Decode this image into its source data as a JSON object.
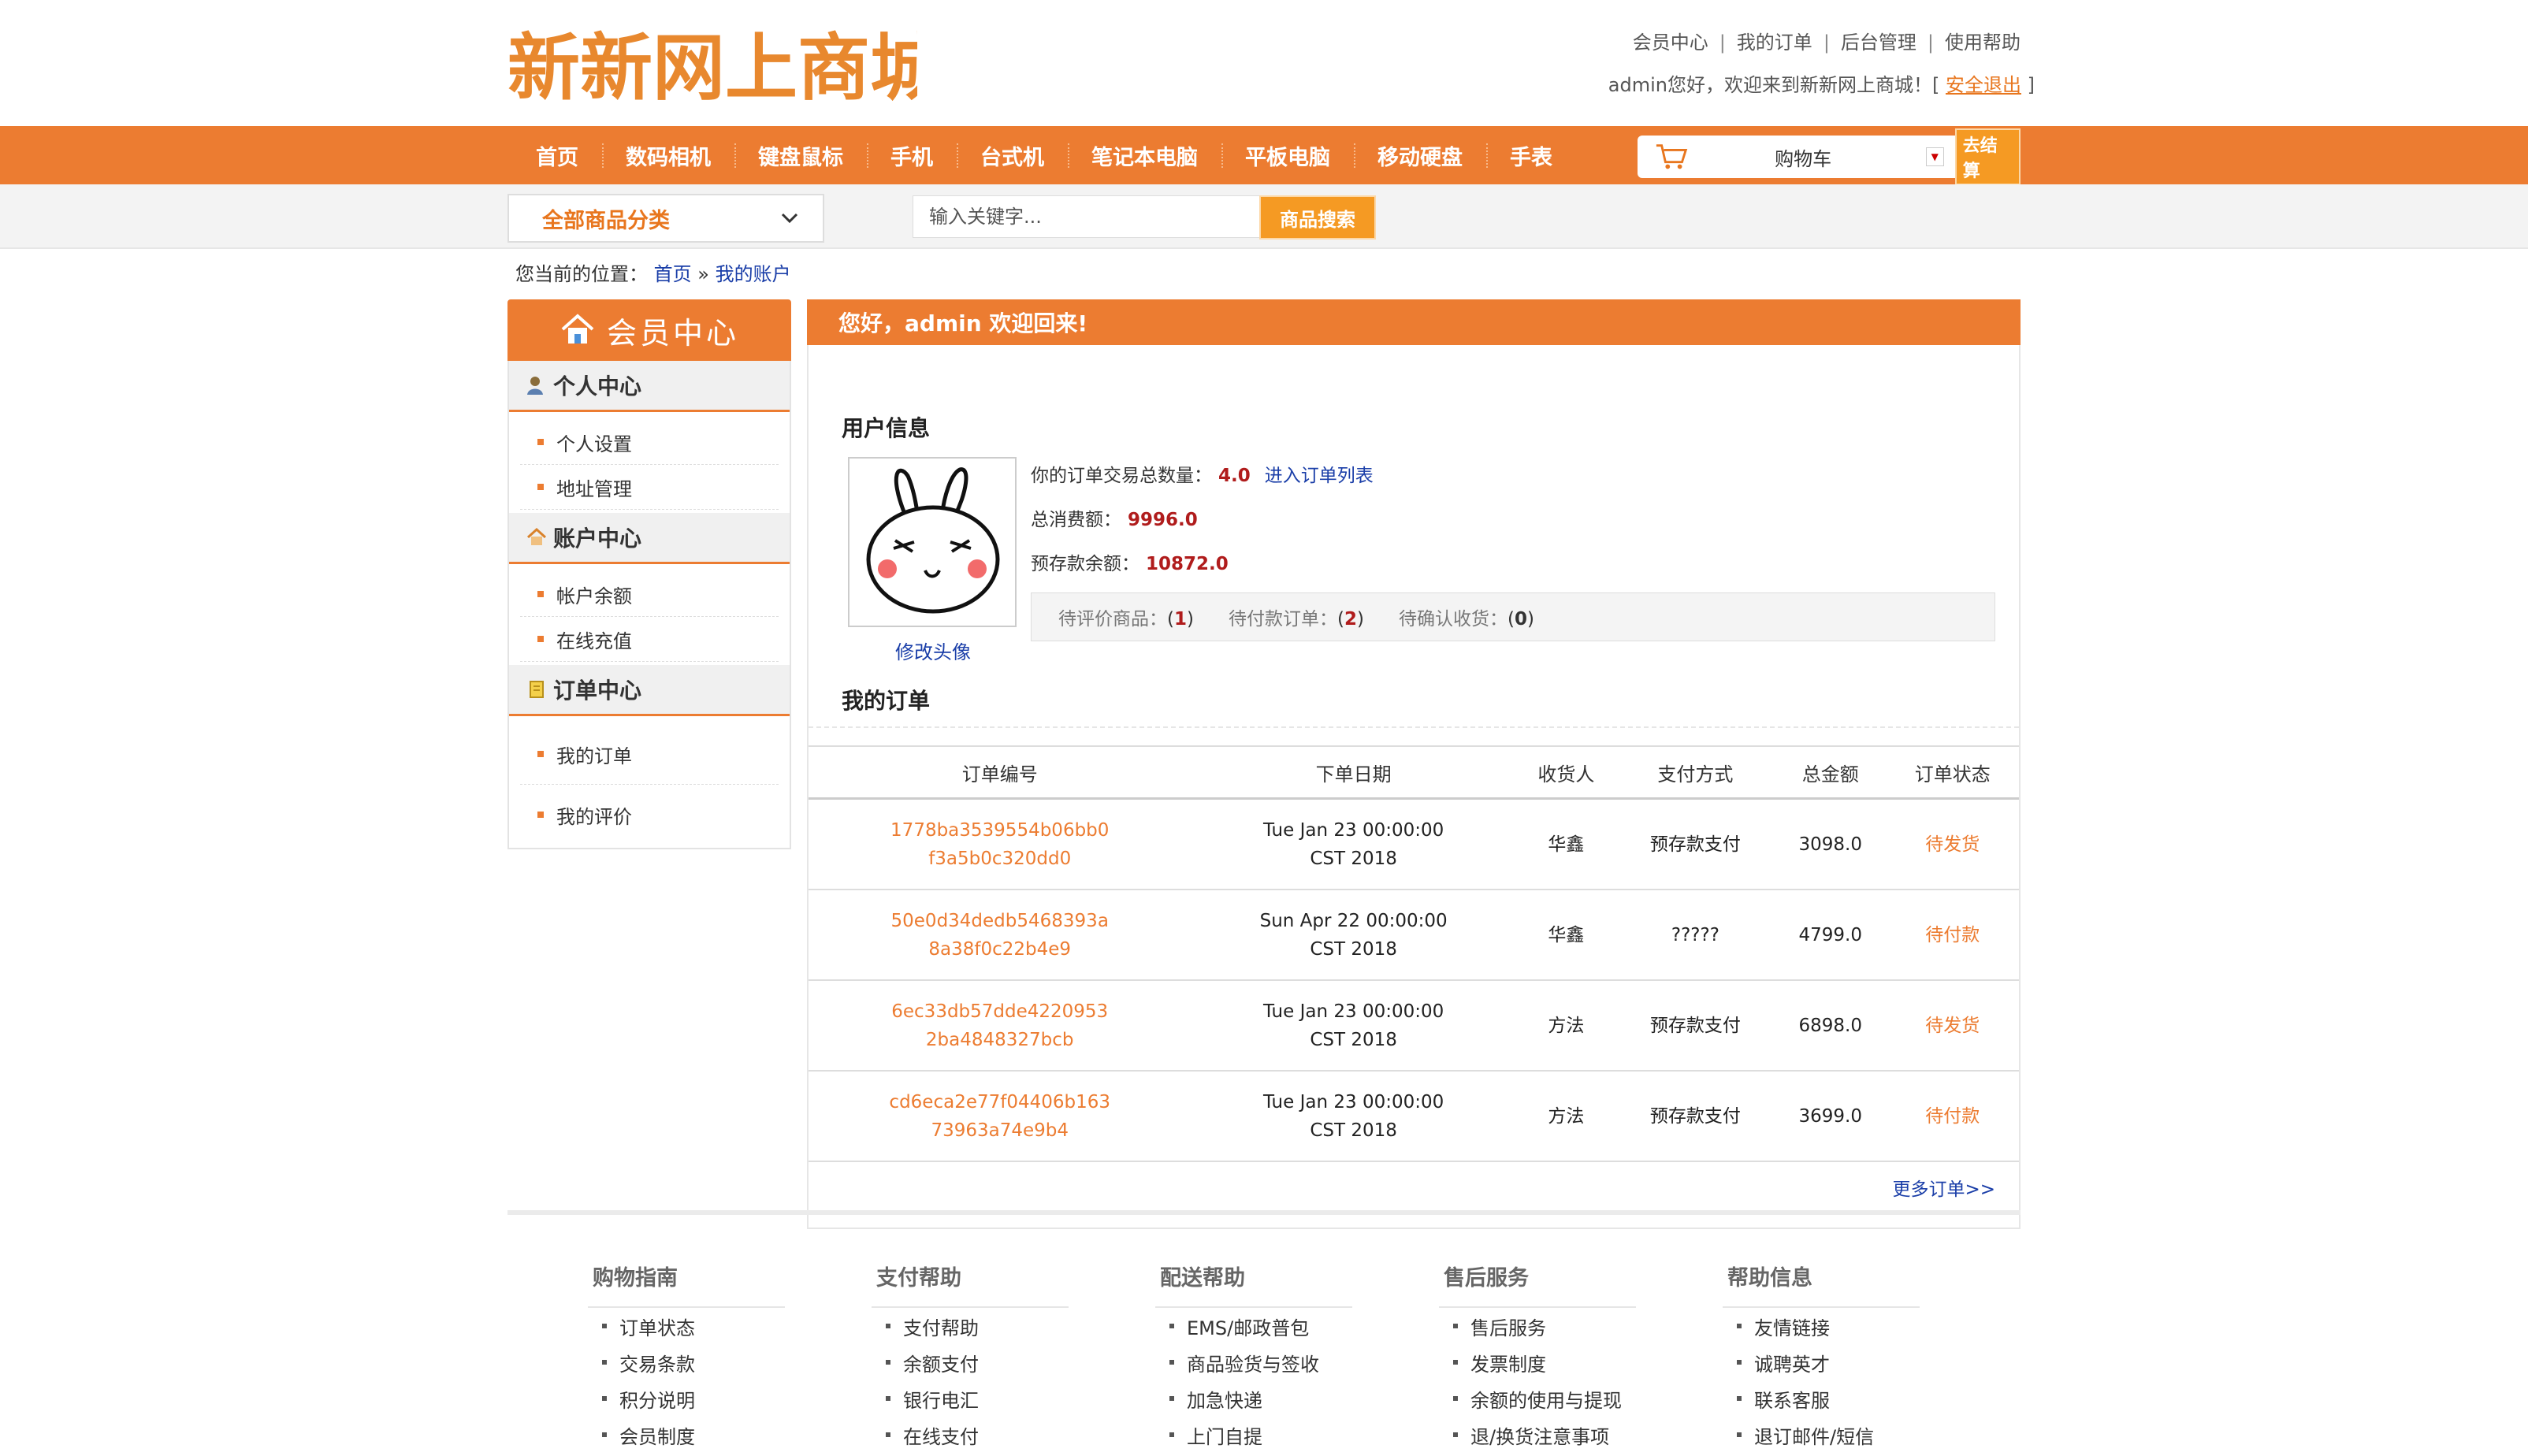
{
  "header": {
    "logo_text": "新新网上商城",
    "top_links": [
      "会员中心",
      "我的订单",
      "后台管理",
      "使用帮助"
    ],
    "greeting": "admin您好，欢迎来到新新网上商城！[",
    "logout": "安全退出",
    "greeting_end": "]"
  },
  "nav": {
    "items": [
      "首页",
      "数码相机",
      "键盘鼠标",
      "手机",
      "台式机",
      "笔记本电脑",
      "平板电脑",
      "移动硬盘",
      "手表"
    ],
    "cart_label": "购物车",
    "checkout": "去结算"
  },
  "subbar": {
    "category": "全部商品分类",
    "search_placeholder": "输入关键字...",
    "search_button": "商品搜索"
  },
  "breadcrumb": {
    "prefix": "您当前的位置：",
    "home": "首页",
    "sep": "»",
    "current": "我的账户"
  },
  "sidebar": {
    "title": "会员中心",
    "sections": [
      {
        "title": "个人中心",
        "items": [
          "个人设置",
          "地址管理"
        ]
      },
      {
        "title": "账户中心",
        "items": [
          "帐户余额",
          "在线充值"
        ]
      },
      {
        "title": "订单中心",
        "items": [
          "我的订单",
          "我的评价"
        ]
      }
    ]
  },
  "main": {
    "welcome": "您好，admin 欢迎回来!",
    "user_info_title": "用户信息",
    "edit_avatar": "修改头像",
    "order_count_label": "你的订单交易总数量：",
    "order_count": "4.0",
    "order_list_link": "进入订单列表",
    "total_spent_label": "总消费额：",
    "total_spent": "9996.0",
    "balance_label": "预存款余额：",
    "balance": "10872.0",
    "pending": {
      "review_label": "待评价商品：",
      "review_count": "1",
      "unpaid_label": "待付款订单：",
      "unpaid_count": "2",
      "confirm_label": "待确认收货：",
      "confirm_count": "0",
      "open": "(",
      "close": ")"
    },
    "orders_title": "我的订单",
    "orders_headers": [
      "订单编号",
      "下单日期",
      "收货人",
      "支付方式",
      "总金额",
      "订单状态"
    ],
    "orders": [
      {
        "id1": "1778ba3539554b06bb0",
        "id2": "f3a5b0c320dd0",
        "date1": "Tue Jan 23 00:00:00",
        "date2": "CST 2018",
        "receiver": "华鑫",
        "payment": "预存款支付",
        "amount": "3098.0",
        "status": "待发货"
      },
      {
        "id1": "50e0d34dedb5468393a",
        "id2": "8a38f0c22b4e9",
        "date1": "Sun Apr 22 00:00:00",
        "date2": "CST 2018",
        "receiver": "华鑫",
        "payment": "?????",
        "amount": "4799.0",
        "status": "待付款"
      },
      {
        "id1": "6ec33db57dde4220953",
        "id2": "2ba4848327bcb",
        "date1": "Tue Jan 23 00:00:00",
        "date2": "CST 2018",
        "receiver": "方法",
        "payment": "预存款支付",
        "amount": "6898.0",
        "status": "待发货"
      },
      {
        "id1": "cd6eca2e77f04406b163",
        "id2": "73963a74e9b4",
        "date1": "Tue Jan 23 00:00:00",
        "date2": "CST 2018",
        "receiver": "方法",
        "payment": "预存款支付",
        "amount": "3699.0",
        "status": "待付款"
      }
    ],
    "more_orders": "更多订单>>"
  },
  "footer": {
    "columns": [
      {
        "title": "购物指南",
        "items": [
          "订单状态",
          "交易条款",
          "积分说明",
          "会员制度"
        ]
      },
      {
        "title": "支付帮助",
        "items": [
          "支付帮助",
          "余额支付",
          "银行电汇",
          "在线支付"
        ]
      },
      {
        "title": "配送帮助",
        "items": [
          "EMS/邮政普包",
          "商品验货与签收",
          "加急快递",
          "上门自提"
        ]
      },
      {
        "title": "售后服务",
        "items": [
          "售后服务",
          "发票制度",
          "余额的使用与提现",
          "退/换货注意事项"
        ]
      },
      {
        "title": "帮助信息",
        "items": [
          "友情链接",
          "诚聘英才",
          "联系客服",
          "退订邮件/短信"
        ]
      }
    ]
  },
  "colors": {
    "accent": "#ec7c31",
    "link": "#1a3ea8",
    "value": "#b01c1c",
    "button": "#f59a23"
  }
}
